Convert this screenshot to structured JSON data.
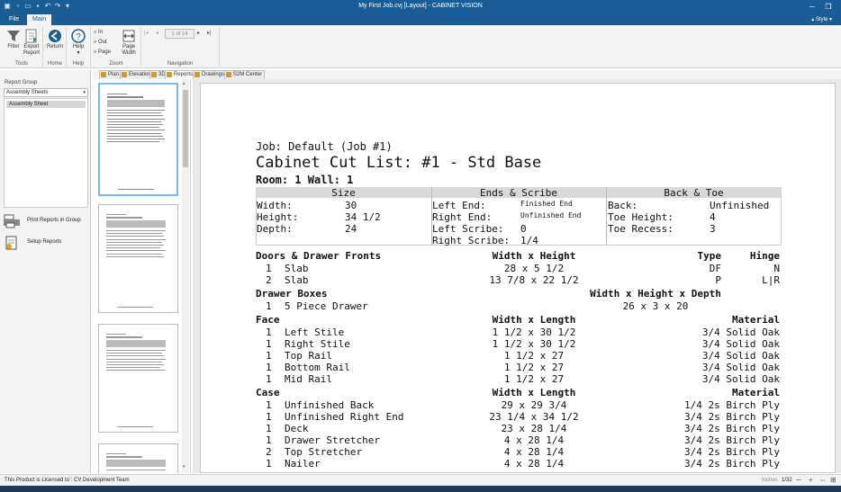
{
  "window": {
    "title": "My First Job.cvj [Layout] - CABINET VISION"
  },
  "ribbon_tabs": [
    {
      "label": "File"
    },
    {
      "label": "Main"
    }
  ],
  "style_menu": "Style",
  "ribbon": {
    "filter": "Filter",
    "export_report": "Export Report",
    "return": "Return",
    "help": "Help",
    "zoom_in": "In",
    "zoom_out": "Out",
    "zoom_page": "Page",
    "page_width": "Page Width",
    "page_indicator": "1 of 14",
    "groups": {
      "tools": "Tools",
      "home": "Home",
      "help": "Help",
      "zoom": "Zoom",
      "navigation": "Navigation"
    }
  },
  "view_tabs": [
    {
      "label": "Plan"
    },
    {
      "label": "Elevation"
    },
    {
      "label": "3D"
    },
    {
      "label": "Reports"
    },
    {
      "label": "Drawings"
    },
    {
      "label": "S2M Center"
    }
  ],
  "left_panel": {
    "report_group_label": "Report Group",
    "report_group_value": "Assembly Sheets",
    "list_items": [
      "Assembly Sheet"
    ],
    "print_reports": "Print Reports in Group",
    "setup_reports": "Setup Reports"
  },
  "report": {
    "job_line": "Job: Default (Job #1)",
    "title": "Cabinet Cut List: #1 - Std Base",
    "room_line": "Room: 1 Wall: 1",
    "size_header": "Size",
    "ends_header": "Ends & Scribe",
    "back_header": "Back & Toe",
    "size_rows": [
      [
        "Width:",
        "30"
      ],
      [
        "Height:",
        "34 1/2"
      ],
      [
        "Depth:",
        "24"
      ]
    ],
    "ends_rows": [
      [
        "Left End:",
        "Finished End"
      ],
      [
        "Right End:",
        "Unfinished End"
      ],
      [
        "Left Scribe:",
        "0"
      ],
      [
        "Right Scribe:",
        "1/4"
      ]
    ],
    "back_rows": [
      [
        "Back:",
        "Unfinished"
      ],
      [
        "Toe Height:",
        "4"
      ],
      [
        "Toe Recess:",
        "3"
      ]
    ],
    "doors": {
      "title": "Doors & Drawer Fronts",
      "col_dim": "Width x Height",
      "col_type": "Type",
      "col_hinge": "Hinge",
      "rows": [
        {
          "qty": "1",
          "name": "Slab",
          "dim": "28 x 5 1/2",
          "type": "DF",
          "hinge": "N"
        },
        {
          "qty": "2",
          "name": "Slab",
          "dim": "13 7/8 x 22 1/2",
          "type": "P",
          "hinge": "L|R"
        }
      ]
    },
    "drawer_boxes": {
      "title": "Drawer Boxes",
      "col_dim": "Width x Height x Depth",
      "rows": [
        {
          "qty": "1",
          "name": "5 Piece Drawer",
          "dim": "26 x 3 x 20"
        }
      ]
    },
    "face": {
      "title": "Face",
      "col_dim": "Width x Length",
      "col_mat": "Material",
      "rows": [
        {
          "qty": "1",
          "name": "Left Stile",
          "dim": "1 1/2 x 30 1/2",
          "mat": "3/4 Solid Oak"
        },
        {
          "qty": "1",
          "name": "Right Stile",
          "dim": "1 1/2 x 30 1/2",
          "mat": "3/4 Solid Oak"
        },
        {
          "qty": "1",
          "name": "Top Rail",
          "dim": "1 1/2 x 27",
          "mat": "3/4 Solid Oak"
        },
        {
          "qty": "1",
          "name": "Bottom Rail",
          "dim": "1 1/2 x 27",
          "mat": "3/4 Solid Oak"
        },
        {
          "qty": "1",
          "name": "Mid Rail",
          "dim": "1 1/2 x 27",
          "mat": "3/4 Solid Oak"
        }
      ]
    },
    "case": {
      "title": "Case",
      "col_dim": "Width x Length",
      "col_mat": "Material",
      "rows": [
        {
          "qty": "1",
          "name": "Unfinished Back",
          "dim": "29 x 29 3/4",
          "mat": "1/4 2s Birch Ply"
        },
        {
          "qty": "1",
          "name": "Unfinished Right End",
          "dim": "23 1/4 x 34 1/2",
          "mat": "3/4 2s Birch Ply"
        },
        {
          "qty": "1",
          "name": "Deck",
          "dim": "23 x 28 1/4",
          "mat": "3/4 2s Birch Ply"
        },
        {
          "qty": "1",
          "name": "Drawer Stretcher",
          "dim": "4 x 28 1/4",
          "mat": "3/4 2s Birch Ply"
        },
        {
          "qty": "2",
          "name": "Top Stretcher",
          "dim": "4 x 28 1/4",
          "mat": "3/4 2s Birch Ply"
        },
        {
          "qty": "1",
          "name": "Nailer",
          "dim": "4 x 28 1/4",
          "mat": "3/4 2s Birch Ply"
        }
      ]
    }
  },
  "status": {
    "license": "This Product is Licensed to : CV Development Team",
    "units": "Inches",
    "precision": "1/32"
  },
  "colors": {
    "titlebar": "#1a5c96",
    "ribbon": "#f3f3f3",
    "table_header": "#d9d9d9",
    "thumb_selected": "#79b8e8"
  }
}
